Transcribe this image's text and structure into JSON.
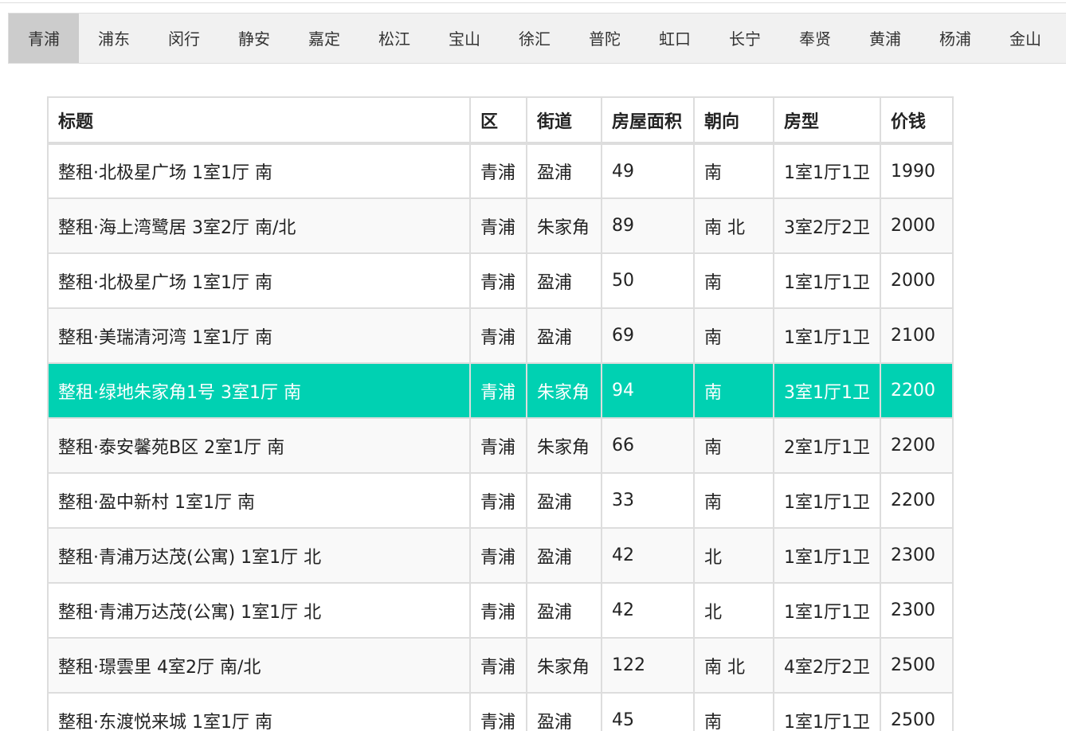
{
  "tabs": [
    {
      "label": "青浦",
      "active": true
    },
    {
      "label": "浦东"
    },
    {
      "label": "闵行"
    },
    {
      "label": "静安"
    },
    {
      "label": "嘉定"
    },
    {
      "label": "松江"
    },
    {
      "label": "宝山"
    },
    {
      "label": "徐汇"
    },
    {
      "label": "普陀"
    },
    {
      "label": "虹口"
    },
    {
      "label": "长宁"
    },
    {
      "label": "奉贤"
    },
    {
      "label": "黄浦"
    },
    {
      "label": "杨浦"
    },
    {
      "label": "金山"
    }
  ],
  "table": {
    "headers": [
      "标题",
      "区",
      "街道",
      "房屋面积",
      "朝向",
      "房型",
      "价钱"
    ],
    "highlight_color": "#00d1b2",
    "rows": [
      [
        "整租·北极星广场 1室1厅 南",
        "青浦",
        "盈浦",
        "49",
        "南",
        "1室1厅1卫",
        "1990"
      ],
      [
        "整租·海上湾鹭居 3室2厅 南/北",
        "青浦",
        "朱家角",
        "89",
        "南 北",
        "3室2厅2卫",
        "2000"
      ],
      [
        "整租·北极星广场 1室1厅 南",
        "青浦",
        "盈浦",
        "50",
        "南",
        "1室1厅1卫",
        "2000"
      ],
      [
        "整租·美瑞清河湾 1室1厅 南",
        "青浦",
        "盈浦",
        "69",
        "南",
        "1室1厅1卫",
        "2100"
      ],
      [
        "整租·绿地朱家角1号 3室1厅 南",
        "青浦",
        "朱家角",
        "94",
        "南",
        "3室1厅1卫",
        "2200"
      ],
      [
        "整租·泰安馨苑B区 2室1厅 南",
        "青浦",
        "朱家角",
        "66",
        "南",
        "2室1厅1卫",
        "2200"
      ],
      [
        "整租·盈中新村 1室1厅 南",
        "青浦",
        "盈浦",
        "33",
        "南",
        "1室1厅1卫",
        "2200"
      ],
      [
        "整租·青浦万达茂(公寓) 1室1厅 北",
        "青浦",
        "盈浦",
        "42",
        "北",
        "1室1厅1卫",
        "2300"
      ],
      [
        "整租·青浦万达茂(公寓) 1室1厅 北",
        "青浦",
        "盈浦",
        "42",
        "北",
        "1室1厅1卫",
        "2300"
      ],
      [
        "整租·璟雲里 4室2厅 南/北",
        "青浦",
        "朱家角",
        "122",
        "南 北",
        "4室2厅2卫",
        "2500"
      ],
      [
        "整租·东渡悦来城 1室1厅 南",
        "青浦",
        "盈浦",
        "45",
        "南",
        "1室1厅1卫",
        "2500"
      ]
    ],
    "highlighted_row": 4
  }
}
